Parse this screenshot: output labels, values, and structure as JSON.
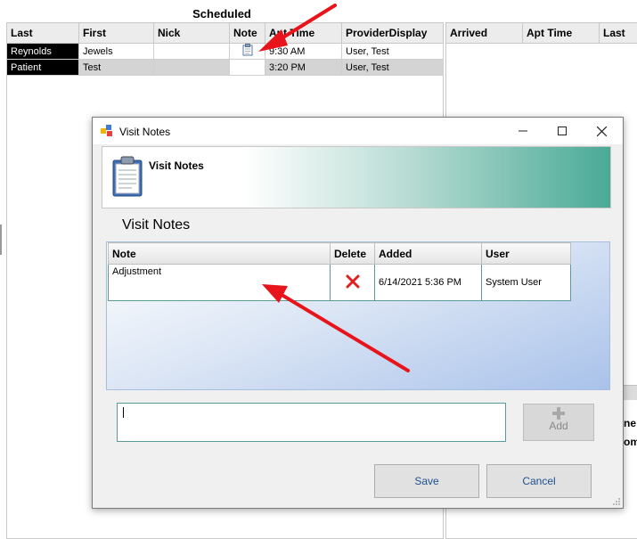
{
  "scheduled": {
    "title": "Scheduled",
    "columns": [
      "Last",
      "First",
      "Nick",
      "Note",
      "Apt Time",
      "ProviderDisplay"
    ],
    "rows": [
      {
        "last": "Reynolds",
        "first": "Jewels",
        "nick": "",
        "apt_time": "9:30 AM",
        "provider": "User, Test"
      },
      {
        "last": "Patient",
        "first": "Test",
        "nick": "",
        "apt_time": "3:20 PM",
        "provider": "User, Test"
      }
    ]
  },
  "arrived": {
    "columns": [
      "Arrived",
      "Apt Time",
      "Last"
    ]
  },
  "dialog": {
    "window_title": "Visit Notes",
    "banner_title": "Visit Notes",
    "section_title": "Visit Notes",
    "grid": {
      "columns": [
        "Note",
        "Delete",
        "Added",
        "User"
      ],
      "rows": [
        {
          "note": "Adjustment",
          "added": "6/14/2021 5:36 PM",
          "user": "System User"
        }
      ]
    },
    "input": {
      "value": ""
    },
    "add_label": "Add",
    "save_label": "Save",
    "cancel_label": "Cancel"
  },
  "background_fragments": {
    "frag1": "ne",
    "frag2": "om"
  },
  "colors": {
    "arrow": "#e8141b",
    "teal": "#4aaa96",
    "button_text": "#1f4f8f"
  },
  "icons": [
    "clipboard-icon",
    "app-icon",
    "minimize-icon",
    "maximize-icon",
    "close-icon",
    "delete-x-icon",
    "plus-icon"
  ]
}
